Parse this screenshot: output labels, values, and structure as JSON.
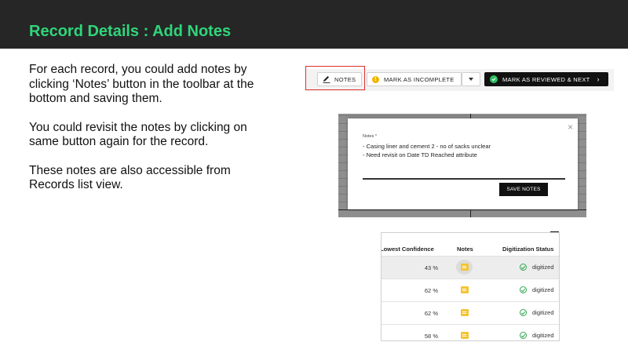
{
  "slide": {
    "title": "Record Details : Add Notes",
    "paragraphs": [
      "For each record, you could add notes by clicking ‘Notes’ button in the toolbar at the bottom and saving them.",
      "You could revisit the notes by clicking on same button again for the record.",
      "These notes are also accessible from Records list view."
    ]
  },
  "toolbar": {
    "notes_label": "NOTES",
    "mark_incomplete_label": "MARK AS INCOMPLETE",
    "mark_reviewed_label": "MARK AS REVIEWED & NEXT",
    "colors": {
      "highlight": "#e0302e",
      "warning": "#f0b400",
      "success": "#2fbf5f"
    }
  },
  "notes_dialog": {
    "label": "Notes *",
    "lines": [
      "- Casing liner and cement 2 - no of sacks unclear",
      "- Need revisit on Date TD Reached attribute"
    ],
    "close_glyph": "×",
    "save_label": "SAVE NOTES"
  },
  "records_table": {
    "columns": [
      "Lowest Confidence",
      "Notes",
      "Digitization Status"
    ],
    "rows": [
      {
        "confidence": "43 %",
        "status": "digitized"
      },
      {
        "confidence": "62 %",
        "status": "digitized"
      },
      {
        "confidence": "62 %",
        "status": "digitized"
      },
      {
        "confidence": "58 %",
        "status": "digitized"
      }
    ]
  }
}
